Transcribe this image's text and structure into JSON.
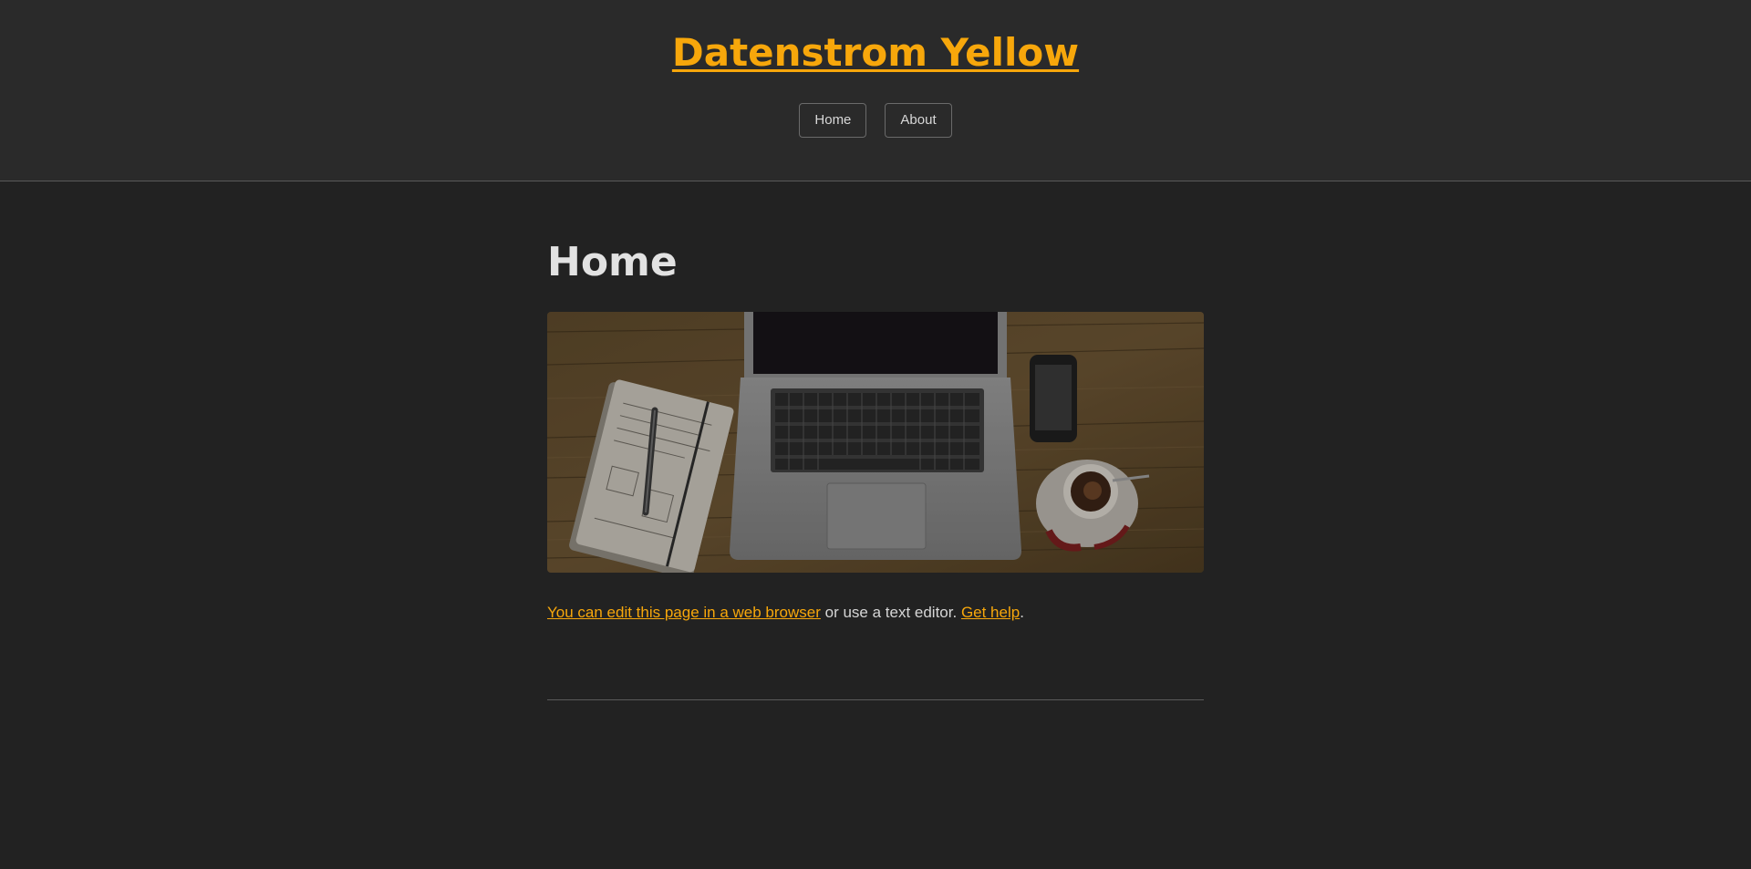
{
  "site": {
    "title": "Datenstrom Yellow"
  },
  "nav": {
    "items": [
      {
        "label": "Home"
      },
      {
        "label": "About"
      }
    ]
  },
  "main": {
    "title": "Home",
    "paragraph": {
      "edit_link": "You can edit this page in a web browser",
      "middle_text": " or use a text editor. ",
      "help_link": "Get help",
      "end_text": "."
    }
  },
  "colors": {
    "accent": "#f7a70b",
    "header_bg": "#2a2a2a",
    "body_bg": "#222222",
    "text": "#d6d6d6"
  }
}
